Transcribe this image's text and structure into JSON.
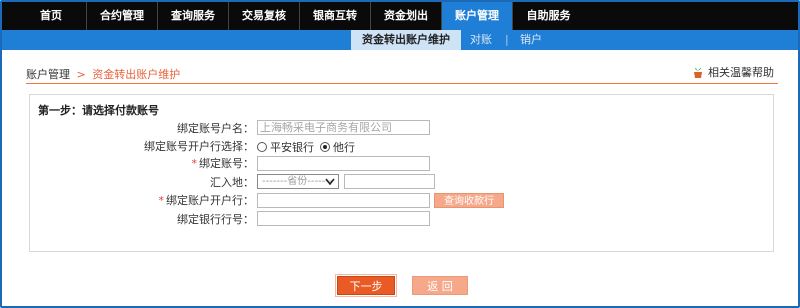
{
  "nav": {
    "items": [
      {
        "label": "首页"
      },
      {
        "label": "合约管理"
      },
      {
        "label": "查询服务"
      },
      {
        "label": "交易复核"
      },
      {
        "label": "银商互转"
      },
      {
        "label": "资金划出"
      },
      {
        "label": "账户管理"
      },
      {
        "label": "自助服务"
      }
    ],
    "active_index": 6
  },
  "subnav": {
    "items": [
      {
        "label": "资金转出账户维护"
      },
      {
        "label": "对账"
      },
      {
        "label": "销户"
      }
    ],
    "separator": "|"
  },
  "breadcrumb": {
    "root": "账户管理",
    "arrow": ">",
    "current": "资金转出账户维护"
  },
  "help": {
    "label": "相关温馨帮助"
  },
  "form": {
    "step_title": "第一步：请选择付款账号",
    "fields": {
      "account_name_label": "绑定账号户名：",
      "account_name_value": "上海畅采电子商务有限公司",
      "bank_choice_label": "绑定账号开户行选择：",
      "bank_option_1": "平安银行",
      "bank_option_2": "他行",
      "bank_selected": "他行",
      "account_no_label": "绑定账号：",
      "remit_place_label": "汇入地：",
      "province_placeholder": "-------省份-------",
      "open_bank_label": "绑定账户开户行：",
      "query_bank_button": "查询收款行",
      "bank_code_label": "绑定银行行号："
    },
    "required_mark": "*"
  },
  "actions": {
    "next_label": "下一步",
    "back_label": "返 回"
  },
  "colors": {
    "nav_bg": "#0a0a0a",
    "accent_blue": "#1f7fd6",
    "accent_orange": "#ea5a24",
    "light_orange": "#f6a88a"
  }
}
